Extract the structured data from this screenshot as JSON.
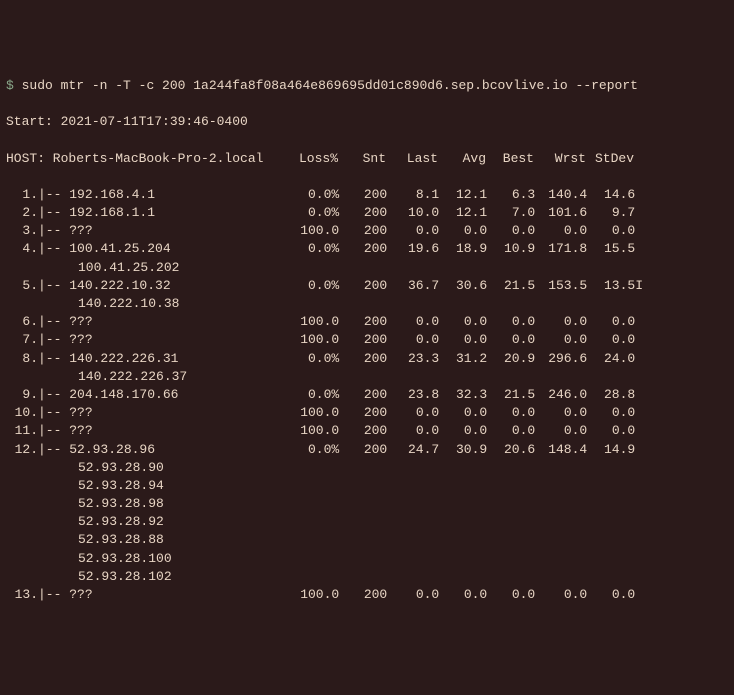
{
  "prompt": "$",
  "command": "sudo mtr -n -T -c 200 1a244fa8f08a464e869695dd01c890d6.sep.bcovlive.io --report",
  "start_line": "Start: 2021-07-11T17:39:46-0400",
  "host_label": "HOST: Roberts-MacBook-Pro-2.local",
  "columns": {
    "loss": "Loss%",
    "snt": "Snt",
    "last": "Last",
    "avg": "Avg",
    "best": "Best",
    "wrst": "Wrst",
    "stdev": "StDev"
  },
  "hops": [
    {
      "num": "1.",
      "sep": "|--",
      "ip": "192.168.4.1",
      "loss": "0.0%",
      "snt": "200",
      "last": "8.1",
      "avg": "12.1",
      "best": "6.3",
      "wrst": "140.4",
      "stdev": "14.6",
      "extra_ips": []
    },
    {
      "num": "2.",
      "sep": "|--",
      "ip": "192.168.1.1",
      "loss": "0.0%",
      "snt": "200",
      "last": "10.0",
      "avg": "12.1",
      "best": "7.0",
      "wrst": "101.6",
      "stdev": "9.7",
      "extra_ips": []
    },
    {
      "num": "3.",
      "sep": "|--",
      "ip": "???",
      "loss": "100.0",
      "snt": "200",
      "last": "0.0",
      "avg": "0.0",
      "best": "0.0",
      "wrst": "0.0",
      "stdev": "0.0",
      "extra_ips": []
    },
    {
      "num": "4.",
      "sep": "|--",
      "ip": "100.41.25.204",
      "loss": "0.0%",
      "snt": "200",
      "last": "19.6",
      "avg": "18.9",
      "best": "10.9",
      "wrst": "171.8",
      "stdev": "15.5",
      "extra_ips": [
        "100.41.25.202"
      ]
    },
    {
      "num": "5.",
      "sep": "|--",
      "ip": "140.222.10.32",
      "loss": "0.0%",
      "snt": "200",
      "last": "36.7",
      "avg": "30.6",
      "best": "21.5",
      "wrst": "153.5",
      "stdev": "13.5",
      "extra_ips": [
        "140.222.10.38"
      ]
    },
    {
      "num": "6.",
      "sep": "|--",
      "ip": "???",
      "loss": "100.0",
      "snt": "200",
      "last": "0.0",
      "avg": "0.0",
      "best": "0.0",
      "wrst": "0.0",
      "stdev": "0.0",
      "extra_ips": []
    },
    {
      "num": "7.",
      "sep": "|--",
      "ip": "???",
      "loss": "100.0",
      "snt": "200",
      "last": "0.0",
      "avg": "0.0",
      "best": "0.0",
      "wrst": "0.0",
      "stdev": "0.0",
      "extra_ips": []
    },
    {
      "num": "8.",
      "sep": "|--",
      "ip": "140.222.226.31",
      "loss": "0.0%",
      "snt": "200",
      "last": "23.3",
      "avg": "31.2",
      "best": "20.9",
      "wrst": "296.6",
      "stdev": "24.0",
      "extra_ips": [
        "140.222.226.37"
      ]
    },
    {
      "num": "9.",
      "sep": "|--",
      "ip": "204.148.170.66",
      "loss": "0.0%",
      "snt": "200",
      "last": "23.8",
      "avg": "32.3",
      "best": "21.5",
      "wrst": "246.0",
      "stdev": "28.8",
      "extra_ips": []
    },
    {
      "num": "10.",
      "sep": "|--",
      "ip": "???",
      "loss": "100.0",
      "snt": "200",
      "last": "0.0",
      "avg": "0.0",
      "best": "0.0",
      "wrst": "0.0",
      "stdev": "0.0",
      "extra_ips": []
    },
    {
      "num": "11.",
      "sep": "|--",
      "ip": "???",
      "loss": "100.0",
      "snt": "200",
      "last": "0.0",
      "avg": "0.0",
      "best": "0.0",
      "wrst": "0.0",
      "stdev": "0.0",
      "extra_ips": []
    },
    {
      "num": "12.",
      "sep": "|--",
      "ip": "52.93.28.96",
      "loss": "0.0%",
      "snt": "200",
      "last": "24.7",
      "avg": "30.9",
      "best": "20.6",
      "wrst": "148.4",
      "stdev": "14.9",
      "extra_ips": [
        "52.93.28.90",
        "52.93.28.94",
        "52.93.28.98",
        "52.93.28.92",
        "52.93.28.88",
        "52.93.28.100",
        "52.93.28.102"
      ]
    },
    {
      "num": "13.",
      "sep": "|--",
      "ip": "???",
      "loss": "100.0",
      "snt": "200",
      "last": "0.0",
      "avg": "0.0",
      "best": "0.0",
      "wrst": "0.0",
      "stdev": "0.0",
      "extra_ips": []
    }
  ],
  "cursor_glyph": "I"
}
